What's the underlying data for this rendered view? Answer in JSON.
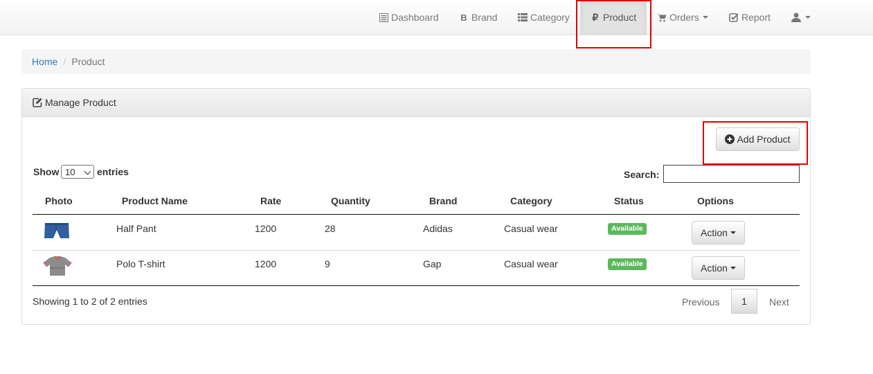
{
  "nav": {
    "items": [
      {
        "label": "Dashboard",
        "icon": "list-icon"
      },
      {
        "label": "Brand",
        "icon": "bitcoin-icon"
      },
      {
        "label": "Category",
        "icon": "th-list-icon"
      },
      {
        "label": "Product",
        "icon": "ruble-icon",
        "active": true
      },
      {
        "label": "Orders",
        "icon": "cart-icon"
      },
      {
        "label": "Report",
        "icon": "check-icon"
      }
    ],
    "user_icon": "user-icon"
  },
  "breadcrumb": {
    "home": "Home",
    "current": "Product"
  },
  "panel": {
    "title": "Manage Product",
    "title_icon": "edit-icon"
  },
  "add_button": {
    "label": "Add Product",
    "icon": "plus-circle-icon"
  },
  "table_controls": {
    "show_label": "Show",
    "entries_value": "10",
    "entries_label": "entries",
    "search_label": "Search:"
  },
  "table": {
    "headers": [
      "Photo",
      "Product Name",
      "Rate",
      "Quantity",
      "Brand",
      "Category",
      "Status",
      "Options"
    ],
    "rows": [
      {
        "name": "Half Pant",
        "rate": "1200",
        "quantity": "28",
        "brand": "Adidas",
        "category": "Casual wear",
        "status": "Available",
        "action": "Action"
      },
      {
        "name": "Polo T-shirt",
        "rate": "1200",
        "quantity": "9",
        "brand": "Gap",
        "category": "Casual wear",
        "status": "Available",
        "action": "Action"
      }
    ]
  },
  "footer": {
    "info": "Showing 1 to 2 of 2 entries",
    "previous": "Previous",
    "page": "1",
    "next": "Next"
  },
  "colors": {
    "link": "#337ab7",
    "badge": "#5cb85c",
    "highlight": "#e00000"
  }
}
